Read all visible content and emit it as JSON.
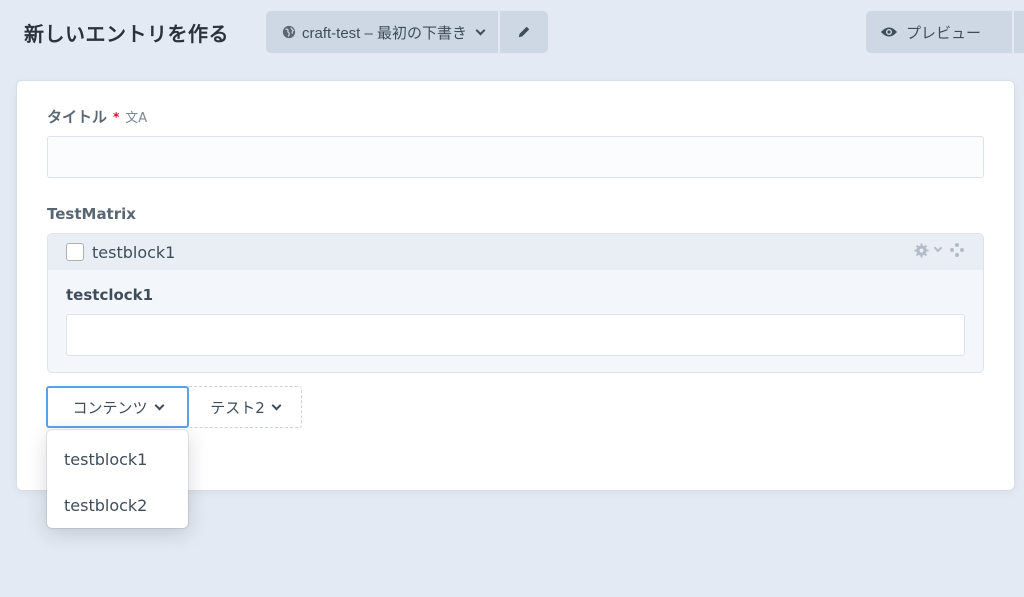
{
  "header": {
    "title": "新しいエントリを作る",
    "site_label": "craft-test – 最初の下書き",
    "preview_label": "プレビュー"
  },
  "fields": {
    "title_label": "タイトル",
    "required_mark": "*",
    "translate_icon": "文A",
    "matrix_label": "TestMatrix"
  },
  "matrix": {
    "block_title": "testblock1",
    "sub_field_label": "testclock1"
  },
  "buttons": {
    "add_content": "コンテンツ",
    "add_test2": "テスト2"
  },
  "menu": {
    "items": [
      {
        "label": "testblock1"
      },
      {
        "label": "testblock2"
      }
    ]
  },
  "colors": {
    "background": "#e4eaf3",
    "button_bg": "#cdd8e4",
    "focus_blue": "#5fa0e4",
    "required_red": "#cf1124"
  },
  "icons": [
    "globe-icon",
    "chevron-down-icon",
    "pencil-icon",
    "eye-icon",
    "translate-icon",
    "gear-icon",
    "move-icon"
  ]
}
